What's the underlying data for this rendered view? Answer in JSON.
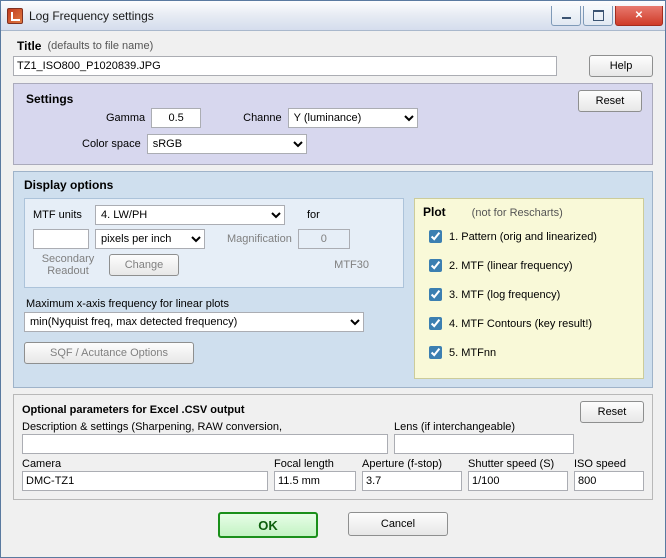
{
  "window": {
    "title": "Log Frequency settings"
  },
  "titleSection": {
    "label": "Title",
    "hint": "(defaults to file name)",
    "value": "TZ1_ISO800_P1020839.JPG",
    "help": "Help"
  },
  "settings": {
    "heading": "Settings",
    "gammaLabel": "Gamma",
    "gammaValue": "0.5",
    "channelLabel": "Channe",
    "channelValue": "Y (luminance)",
    "colorSpaceLabel": "Color space",
    "colorSpaceValue": "sRGB",
    "reset": "Reset"
  },
  "display": {
    "heading": "Display options",
    "mtfUnitsLabel": "MTF units",
    "mtfUnitsValue": "4. LW/PH",
    "forLabel": "for",
    "ppiValue": "",
    "ppiUnit": "pixels per inch",
    "magLabel": "Magnification",
    "magValue": "0",
    "secReadout": "Secondary Readout",
    "change": "Change",
    "mtf30": "MTF30",
    "maxXLabel": "Maximum x-axis frequency for linear plots",
    "maxXValue": "min(Nyquist freq, max detected frequency)",
    "sqfBtn": "SQF / Acutance Options",
    "plot": {
      "heading": "Plot",
      "note": "(not for Rescharts)",
      "items": [
        "1. Pattern (orig and linearized)",
        "2. MTF (linear frequency)",
        "3. MTF (log frequency)",
        "4. MTF Contours (key result!)",
        "5. MTFnn"
      ]
    }
  },
  "optional": {
    "heading": "Optional parameters  for Excel .CSV output",
    "descLabel": "Description & settings (Sharpening, RAW conversion,",
    "descValue": "",
    "lensLabel": "Lens (if interchangeable)",
    "lensValue": "",
    "cameraLabel": "Camera",
    "cameraValue": "DMC-TZ1",
    "focalLabel": "Focal length",
    "focalValue": "11.5 mm",
    "apertureLabel": "Aperture (f-stop)",
    "apertureValue": "3.7",
    "shutterLabel": "Shutter speed (S)",
    "shutterValue": "1/100",
    "isoLabel": "ISO speed",
    "isoValue": "800",
    "reset": "Reset"
  },
  "footer": {
    "ok": "OK",
    "cancel": "Cancel"
  }
}
